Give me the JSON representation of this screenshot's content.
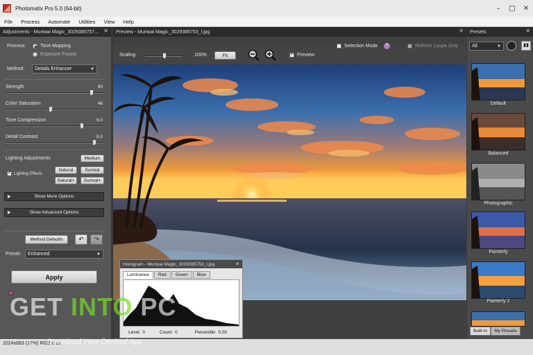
{
  "window": {
    "title": "Photomatix Pro 5.0 (64-bit)",
    "min": "–",
    "max": "□",
    "close": "✕"
  },
  "menu": [
    "File",
    "Process",
    "Automate",
    "Utilities",
    "View",
    "Help"
  ],
  "adjustments": {
    "header": "Adjustments - Muriwai Magic_3029385757...",
    "process_label": "Process:",
    "process_options": [
      "Tone Mapping",
      "Exposure Fusion"
    ],
    "method_label": "Method:",
    "method_value": "Details Enhancer",
    "sliders": [
      {
        "label": "Strength",
        "value": "90",
        "fraction": 0.9
      },
      {
        "label": "Color Saturation",
        "value": "46",
        "fraction": 0.46
      },
      {
        "label": "Tone Compression",
        "value": "6.0",
        "fraction": 0.8
      },
      {
        "label": "Detail Contrast",
        "value": "8.0",
        "fraction": 0.93
      }
    ],
    "lighting_label": "Lighting Adjustments",
    "lighting_effects_label": "Lighting Effects",
    "lighting_buttons": [
      "Medium",
      "Natural",
      "Surreal",
      "Natural+",
      "Surreal+"
    ],
    "show_more": "Show More Options",
    "show_advanced": "Show Advanced Options",
    "method_defaults": "Method Defaults",
    "undo_icon": "undo-icon",
    "redo_icon": "redo-icon",
    "preset_label": "Preset:",
    "preset_value": "Enhanced",
    "apply": "Apply"
  },
  "preview": {
    "header": "Preview - Muriwai Magic_3029385753_l.jpg",
    "scaling_label": "Scaling:",
    "scaling_value": "100%",
    "fit": "Fit",
    "zoom_out_icon": "zoom-out-icon",
    "zoom_in_icon": "zoom-in-icon",
    "preview_label": "Preview",
    "selection_mode": "Selection Mode",
    "refresh_loupe": "Refresh Loupe Only",
    "help_icon": "help-icon"
  },
  "presets": {
    "header": "Presets",
    "filter": "All",
    "items": [
      "Default",
      "Balanced",
      "Photographic",
      "Painterly",
      "Painterly 2"
    ],
    "tabs": [
      "Built-In",
      "My Presets"
    ]
  },
  "histogram": {
    "header": "Histogram - Muriwai Magic_3029385753_l.jpg",
    "tabs": [
      "Luminance",
      "Red",
      "Green",
      "Blue"
    ],
    "level_label": "Level:",
    "level": "0",
    "count_label": "Count:",
    "count": "0",
    "percentile_label": "Percentile:",
    "percentile": "0.00"
  },
  "status": {
    "text": "1024x683 (17%) RGB 8 bit"
  },
  "watermark": {
    "get": "GET ",
    "into": "INTO ",
    "pc": "PC",
    "sub": "Download Your Desired App"
  }
}
